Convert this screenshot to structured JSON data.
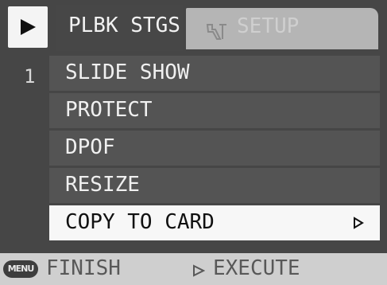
{
  "header": {
    "mode_icon": "play-triangle-icon",
    "active_tab_label": "PLBK STGS",
    "inactive_tab_icon": "wrench-icon",
    "inactive_tab_label": "SETUP"
  },
  "page_number": "1",
  "menu": {
    "items": [
      {
        "label": "SLIDE SHOW",
        "selected": false
      },
      {
        "label": "PROTECT",
        "selected": false
      },
      {
        "label": "DPOF",
        "selected": false
      },
      {
        "label": "RESIZE",
        "selected": false
      },
      {
        "label": "COPY TO CARD",
        "selected": true,
        "icon": "right-arrow-icon"
      }
    ]
  },
  "footer": {
    "menu_badge": "MENU",
    "finish_label": "FINISH",
    "execute_icon": "right-arrow-icon",
    "execute_label": "EXECUTE"
  },
  "colors": {
    "panel": "#464646",
    "item": "#545454",
    "selected_item": "#f7f7f7",
    "footer": "#cfcfcf",
    "inactive_tab": "#b5b5b5"
  }
}
